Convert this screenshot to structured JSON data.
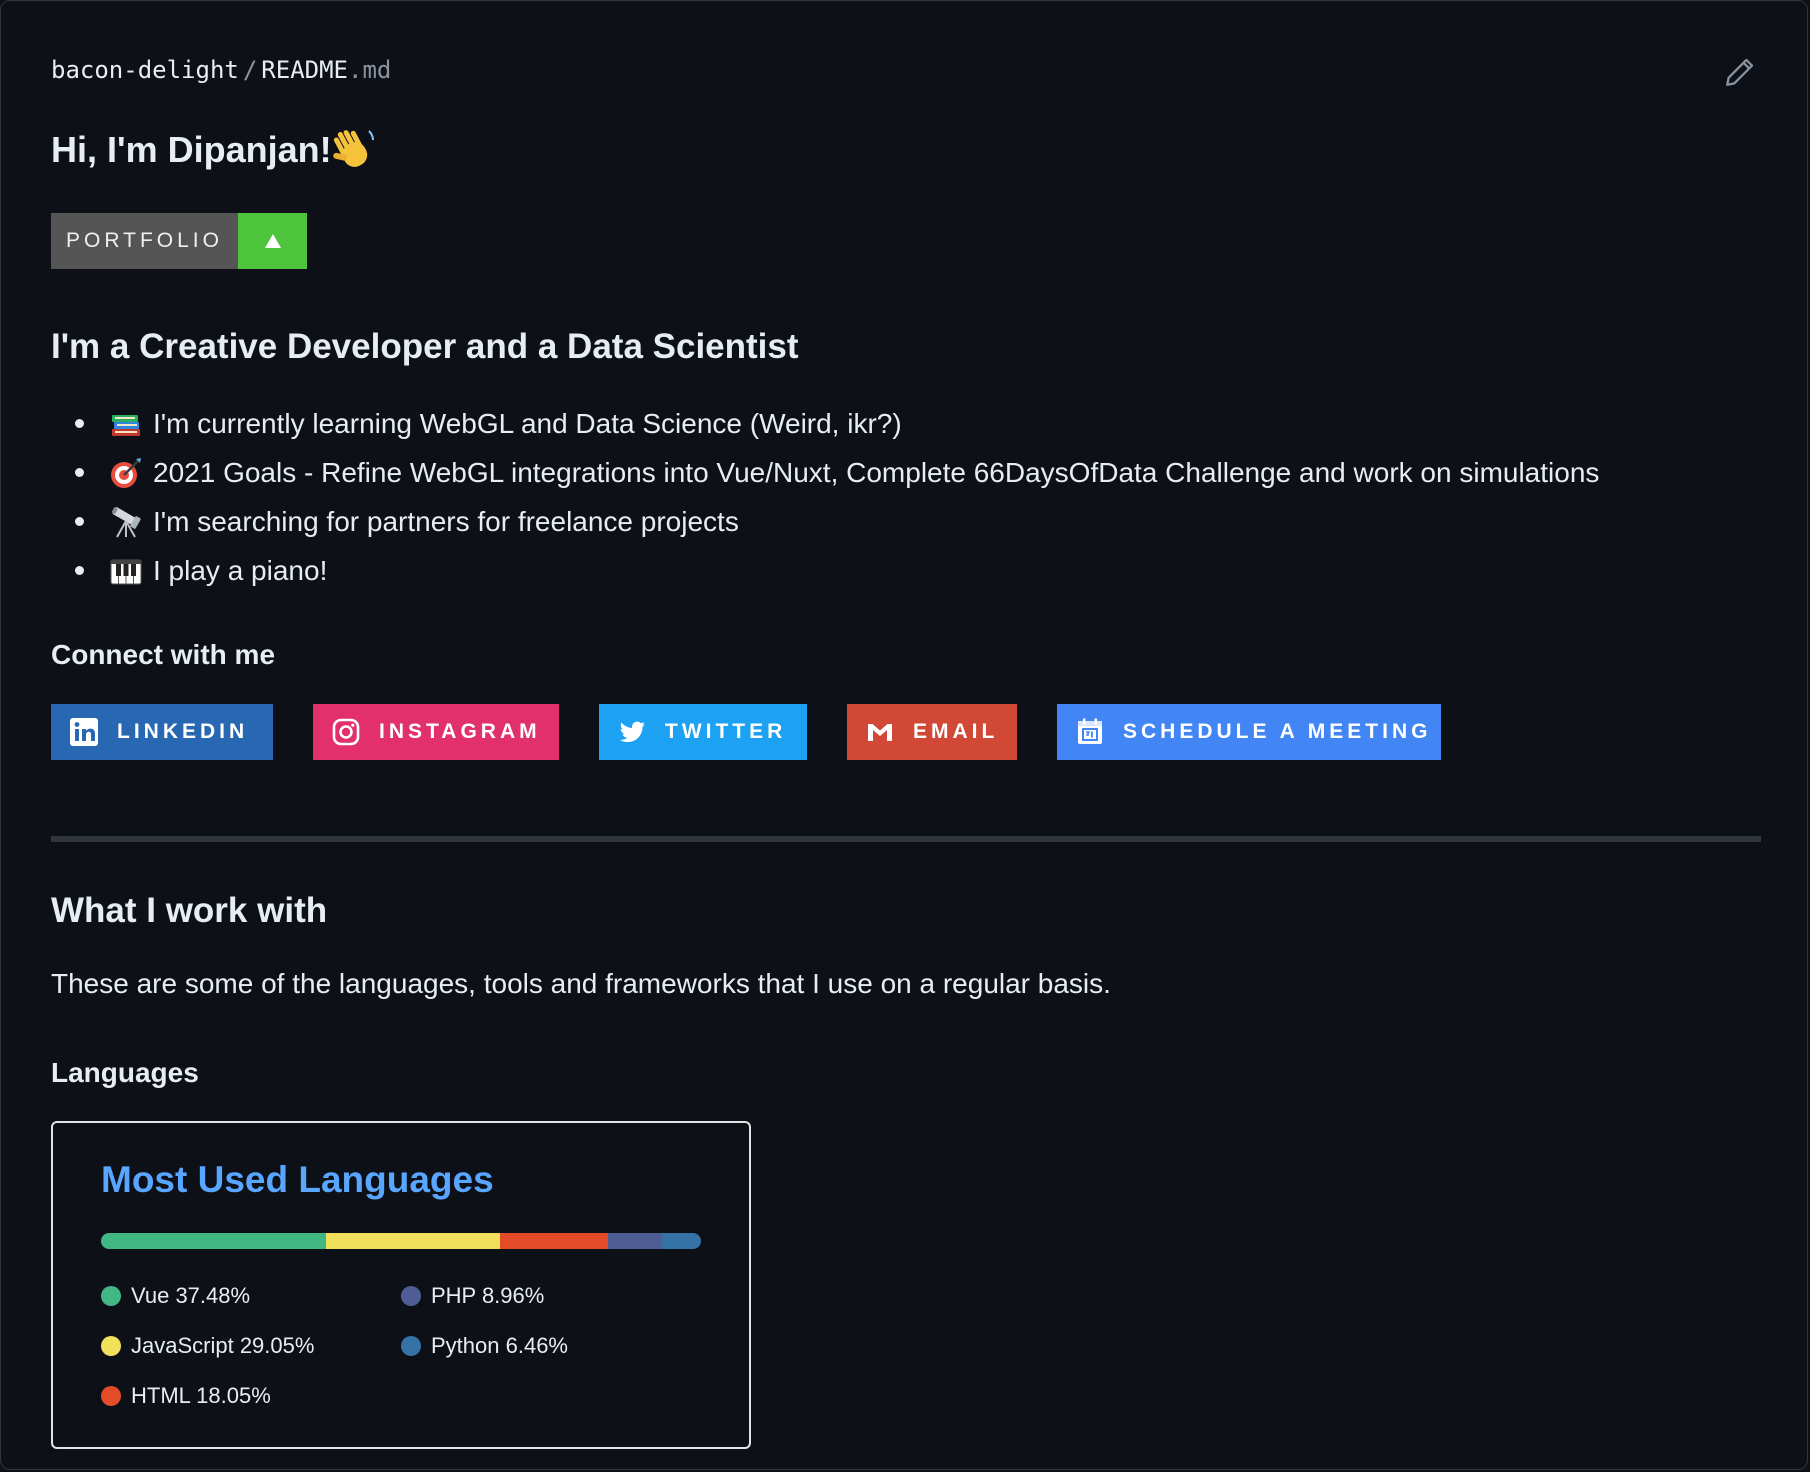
{
  "breadcrumb": {
    "owner": "bacon-delight",
    "separator": "/",
    "file_base": "README",
    "file_ext": ".md"
  },
  "header": {
    "greeting": "Hi, I'm Dipanjan!"
  },
  "portfolio_badge": {
    "label": "PORTFOLIO",
    "label_bg": "#555555",
    "accent_bg": "#4dc43b"
  },
  "intro": {
    "heading": "I'm a Creative Developer and a Data Scientist",
    "items": [
      {
        "icon": "books-icon",
        "text": "I'm currently learning WebGL and Data Science (Weird, ikr?)"
      },
      {
        "icon": "dart-target-icon",
        "text": "2021 Goals - Refine WebGL integrations into Vue/Nuxt, Complete 66DaysOfData Challenge and work on simulations"
      },
      {
        "icon": "telescope-icon",
        "text": "I'm searching for partners for freelance projects"
      },
      {
        "icon": "piano-keys-icon",
        "text": "I play a piano!"
      }
    ]
  },
  "connect": {
    "heading": "Connect with me",
    "badges": [
      {
        "label": "LINKEDIN",
        "icon": "linkedin-icon",
        "color": "#2867b2"
      },
      {
        "label": "INSTAGRAM",
        "icon": "instagram-icon",
        "color": "#e1306c"
      },
      {
        "label": "TWITTER",
        "icon": "twitter-icon",
        "color": "#1da1f2"
      },
      {
        "label": "EMAIL",
        "icon": "gmail-icon",
        "color": "#d14836"
      },
      {
        "label": "SCHEDULE A MEETING",
        "icon": "calendar-icon",
        "color": "#4285f4"
      }
    ]
  },
  "work": {
    "heading": "What I work with",
    "description": "These are some of the languages, tools and frameworks that I use on a regular basis.",
    "languages_heading": "Languages"
  },
  "languages_card": {
    "title": "Most Used Languages",
    "title_color": "#58a6ff",
    "languages": [
      {
        "name": "Vue",
        "percent": 37.48,
        "label": "Vue 37.48%",
        "color": "#41b883"
      },
      {
        "name": "JavaScript",
        "percent": 29.05,
        "label": "JavaScript 29.05%",
        "color": "#f1e05a"
      },
      {
        "name": "HTML",
        "percent": 18.05,
        "label": "HTML 18.05%",
        "color": "#e34c26"
      },
      {
        "name": "PHP",
        "percent": 8.96,
        "label": "PHP 8.96%",
        "color": "#4f5d95"
      },
      {
        "name": "Python",
        "percent": 6.46,
        "label": "Python 6.46%",
        "color": "#3572a5"
      }
    ]
  }
}
